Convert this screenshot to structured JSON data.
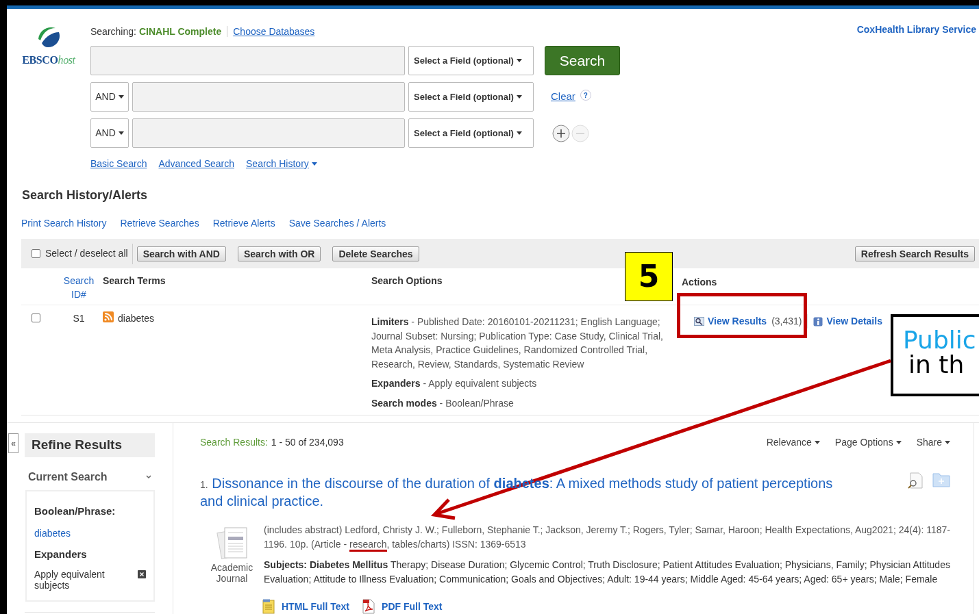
{
  "header": {
    "searching_label": "Searching:",
    "database": "CINAHL Complete",
    "choose_databases": "Choose Databases",
    "institution": "CoxHealth Library Service",
    "logo_main": "EBSCO",
    "logo_sub": "host"
  },
  "search_rows": [
    {
      "field": "Select a Field (optional)"
    },
    {
      "operator": "AND",
      "field": "Select a Field (optional)"
    },
    {
      "operator": "AND",
      "field": "Select a Field (optional)"
    }
  ],
  "search_button": "Search",
  "clear": "Clear",
  "help": "?",
  "search_links": [
    {
      "label": "Basic Search",
      "kind": "link"
    },
    {
      "label": "Advanced Search",
      "kind": "link"
    },
    {
      "label": "Search History",
      "kind": "menu"
    }
  ],
  "history": {
    "title": "Search History/Alerts",
    "links": [
      "Print Search History",
      "Retrieve Searches",
      "Retrieve Alerts",
      "Save Searches / Alerts"
    ],
    "select_all": {
      "label": "Select / deselect all",
      "checked": false
    },
    "buttons": [
      "Search with AND",
      "Search with OR",
      "Delete Searches"
    ],
    "refresh": "Refresh Search Results",
    "columns": [
      "Search ID#",
      "Search Terms",
      "Search Options",
      "Actions"
    ],
    "rows": [
      {
        "checked": false,
        "id": "S1",
        "terms": "diabetes",
        "options": [
          {
            "label": "Limiters",
            "text": "- Published Date: 20160101-20211231; English Language; Journal Subset: Nursing; Publication Type: Case Study, Clinical Trial, Meta Analysis, Practice Guidelines, Randomized Controlled Trial, Research, Review, Standards, Systematic Review"
          },
          {
            "label": "Expanders",
            "text": "- Apply equivalent subjects"
          },
          {
            "label": "Search modes",
            "text": "- Boolean/Phrase"
          }
        ],
        "actions": [
          {
            "kind": "results",
            "label": "View Results",
            "count": "(3,431)"
          },
          {
            "kind": "details",
            "label": "View Details"
          }
        ]
      }
    ]
  },
  "annotations": {
    "step": "5",
    "callout_lines": [
      "Public",
      "in th"
    ]
  },
  "refine": {
    "collapse": "«",
    "title": "Refine Results",
    "current_search": {
      "label": "Current Search",
      "expanded": true
    },
    "boolean_label": "Boolean/Phrase:",
    "term": "diabetes",
    "expanders_label": "Expanders",
    "expander": "Apply equivalent subjects"
  },
  "results": {
    "label": "Search Results:",
    "range": "1 - 50 of 234,093",
    "menus": [
      "Relevance",
      "Page Options",
      "Share"
    ],
    "items": [
      {
        "number": "1.",
        "title": "Dissonance in the discourse of the duration of **diabetes**: A mixed methods study of patient perceptions and clinical practice.",
        "type": "Academic Journal",
        "source_before": "(includes abstract) Ledford, Christy J. W.; Fulleborn, Stephanie T.; Jackson, Jeremy T.; Rogers, Tyler; Samar, Haroon; Health Expectations, Aug2021; 24(4): 1187-1196. 10p. (Article - ",
        "source_marked": "research",
        "source_after": ", tables/charts) ISSN: 1369-6513",
        "subjects": "**Subjects: Diabetes Mellitus** Therapy; Disease Duration; Glycemic Control; Truth Disclosure; Patient Attitudes Evaluation; Physicians, Family; Physician Attitudes Evaluation; Attitude to Illness Evaluation; Communication; Goals and Objectives; Adult: 19-44 years; Middle Aged: 45-64 years; Aged: 65+ years; Male; Female",
        "links": [
          {
            "kind": "html",
            "label": "HTML Full Text"
          },
          {
            "kind": "pdf",
            "label": "PDF Full Text"
          }
        ]
      }
    ]
  }
}
